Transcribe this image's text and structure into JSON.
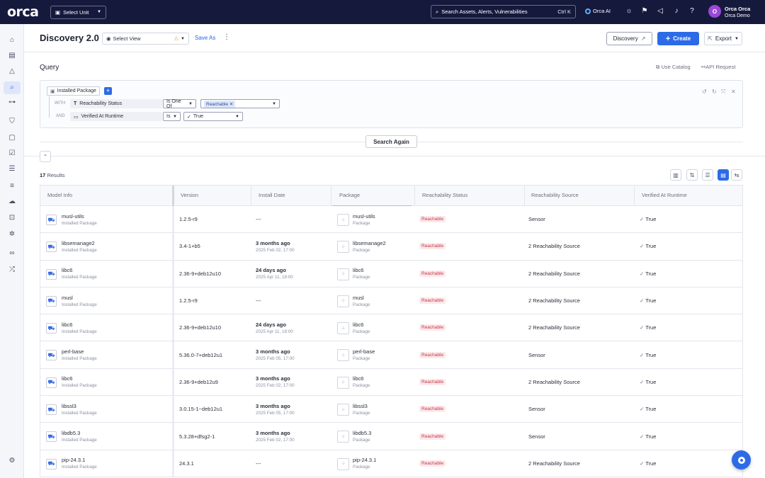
{
  "topbar": {
    "logo": "orca",
    "unit_select": "Select Unit",
    "search_placeholder": "Search Assets, Alerts, Vulnerabilities",
    "search_shortcut": "Ctrl K",
    "orca_ai": "Orca AI",
    "avatar_initial": "O",
    "user_name": "Orca Orca",
    "user_org": "Orca Demo"
  },
  "header": {
    "title": "Discovery 2.0",
    "view_select": "Select View",
    "save_as": "Save As",
    "discovery_btn": "Discovery",
    "create_btn": "Create",
    "export_btn": "Export"
  },
  "query": {
    "label": "Query",
    "use_catalog": "Use Catalog",
    "api_request": "API Request",
    "root": "Installed Package",
    "with_tag": "WITH",
    "and_tag": "AND",
    "cond1_field": "Reachability Status",
    "cond1_op": "Is One Of",
    "cond1_value": "Reachable",
    "cond2_field": "Verified At Runtime",
    "cond2_op": "Is",
    "cond2_value": "True",
    "search_again": "Search Again"
  },
  "results": {
    "count": "17",
    "label": "Results"
  },
  "table": {
    "columns": [
      "Model Info",
      "Version",
      "Install Date",
      "Package",
      "Reachability Status",
      "Reachability Source",
      "Verified At Runtime"
    ],
    "rows": [
      {
        "name": "musl-utils",
        "type": "Installed Package",
        "version": "1.2.5-r9",
        "date": "---",
        "date_sub": "",
        "pkg": "musl-utils",
        "pkg_sub": "Package",
        "status": "Reachable",
        "source": "Sensor",
        "verified": "True"
      },
      {
        "name": "libsemanage2",
        "type": "Installed Package",
        "version": "3.4-1+b5",
        "date": "3 months ago",
        "date_sub": "2025 Feb 02, 17:00",
        "pkg": "libsemanage2",
        "pkg_sub": "Package",
        "status": "Reachable",
        "source": "2 Reachability Source",
        "verified": "True"
      },
      {
        "name": "libc6",
        "type": "Installed Package",
        "version": "2.36-9+deb12u10",
        "date": "24 days ago",
        "date_sub": "2025 Apr 11, 18:00",
        "pkg": "libc6",
        "pkg_sub": "Package",
        "status": "Reachable",
        "source": "2 Reachability Source",
        "verified": "True"
      },
      {
        "name": "musl",
        "type": "Installed Package",
        "version": "1.2.5-r9",
        "date": "---",
        "date_sub": "",
        "pkg": "musl",
        "pkg_sub": "Package",
        "status": "Reachable",
        "source": "2 Reachability Source",
        "verified": "True"
      },
      {
        "name": "libc6",
        "type": "Installed Package",
        "version": "2.36-9+deb12u10",
        "date": "24 days ago",
        "date_sub": "2025 Apr 11, 18:00",
        "pkg": "libc6",
        "pkg_sub": "Package",
        "status": "Reachable",
        "source": "2 Reachability Source",
        "verified": "True"
      },
      {
        "name": "perl-base",
        "type": "Installed Package",
        "version": "5.36.0-7+deb12u1",
        "date": "3 months ago",
        "date_sub": "2025 Feb 05, 17:00",
        "pkg": "perl-base",
        "pkg_sub": "Package",
        "status": "Reachable",
        "source": "Sensor",
        "verified": "True"
      },
      {
        "name": "libc6",
        "type": "Installed Package",
        "version": "2.36-9+deb12u9",
        "date": "3 months ago",
        "date_sub": "2025 Feb 02, 17:00",
        "pkg": "libc6",
        "pkg_sub": "Package",
        "status": "Reachable",
        "source": "2 Reachability Source",
        "verified": "True"
      },
      {
        "name": "libssl3",
        "type": "Installed Package",
        "version": "3.0.15-1~deb12u1",
        "date": "3 months ago",
        "date_sub": "2025 Feb 05, 17:00",
        "pkg": "libssl3",
        "pkg_sub": "Package",
        "status": "Reachable",
        "source": "Sensor",
        "verified": "True"
      },
      {
        "name": "libdb5.3",
        "type": "Installed Package",
        "version": "5.3.28+dfsg2-1",
        "date": "3 months ago",
        "date_sub": "2025 Feb 02, 17:00",
        "pkg": "libdb5.3",
        "pkg_sub": "Package",
        "status": "Reachable",
        "source": "Sensor",
        "verified": "True"
      },
      {
        "name": "pip-24.3.1",
        "type": "Installed Package",
        "version": "24.3.1",
        "date": "---",
        "date_sub": "",
        "pkg": "pip-24.3.1",
        "pkg_sub": "Package",
        "status": "Reachable",
        "source": "2 Reachability Source",
        "verified": "True"
      }
    ]
  },
  "colors": {
    "topbar": "#151a3d",
    "accent": "#2d6be6",
    "reachable_badge": "#c23a4a",
    "avatar": "#9a48d6"
  }
}
